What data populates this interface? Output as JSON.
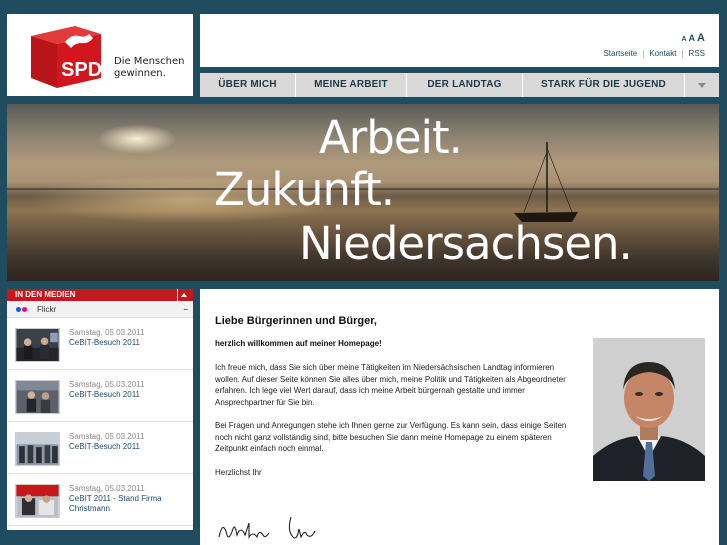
{
  "logo": {
    "brand": "SPD",
    "tagline_line1": "Die Menschen",
    "tagline_line2": "gewinnen."
  },
  "font_sizes": [
    "A",
    "A",
    "A"
  ],
  "top_links": [
    "Startseite",
    "Kontakt",
    "RSS"
  ],
  "nav": {
    "items": [
      "ÜBER MICH",
      "MEINE ARBEIT",
      "DER LANDTAG",
      "STARK FÜR DIE JUGEND"
    ]
  },
  "banner": {
    "line1": "Arbeit.",
    "line2": "Zukunft.",
    "line3": "Niedersachsen."
  },
  "media": {
    "header": "IN DEN MEDIEN",
    "source": "Flickr",
    "collapse": "−",
    "items": [
      {
        "date": "Samstag, 05.03.2011",
        "title": "CeBIT-Besuch 2011"
      },
      {
        "date": "Samstag, 05.03.2011",
        "title": "CeBIT-Besuch 2011"
      },
      {
        "date": "Samstag, 05.03.2011",
        "title": "CeBIT-Besuch 2011"
      },
      {
        "date": "Samstag, 05.03.2011",
        "title": "CeBIT 2011 - Stand Firma Christmann"
      }
    ]
  },
  "content": {
    "heading": "Liebe Bürgerinnen und Bürger,",
    "intro": "herzlich willkommen auf meiner Homepage!",
    "para1": "Ich freue mich, dass Sie sich über meine Tätigkeiten im Niedersächsischen Landtag informieren wollen. Auf dieser Seite können Sie alles über mich, meine Politik und Tätigkeiten als Abgeordneter erfahren. Ich lege viel Wert darauf, dass ich meine Arbeit bürgernah gestalte und immer Ansprechpartner für Sie bin.",
    "para2": "Bei Fragen und Anregungen stehe ich Ihnen gerne zur Verfügung. Es kann sein, dass einige Seiten noch nicht ganz vollständig sind, bitte besuchen Sie dann meine Homepage zu einem späteren Zeitpunkt einfach noch einmal.",
    "closing": "Herzlichst Ihr"
  },
  "colors": {
    "background": "#1f4c5e",
    "spd_red": "#c8161d",
    "nav_bg": "#d9d9d9"
  }
}
